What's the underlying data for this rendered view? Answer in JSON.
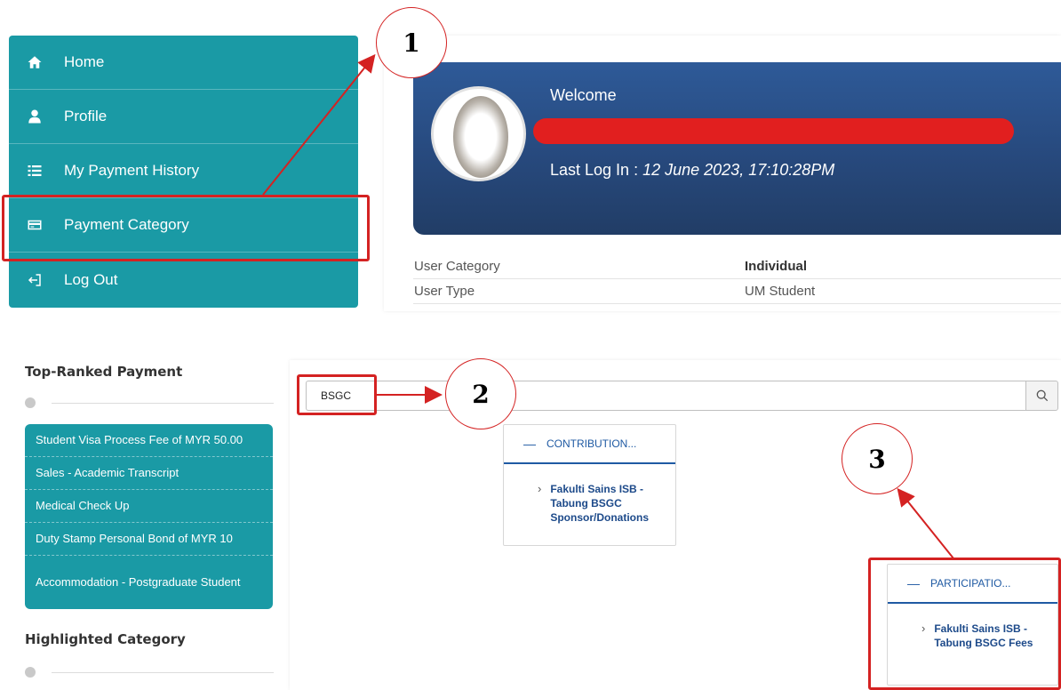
{
  "nav": {
    "items": [
      {
        "label": "Home",
        "icon": "home-icon"
      },
      {
        "label": "Profile",
        "icon": "user-icon"
      },
      {
        "label": "My Payment History",
        "icon": "list-icon"
      },
      {
        "label": "Payment Category",
        "icon": "credit-card-icon"
      },
      {
        "label": "Log Out",
        "icon": "logout-icon"
      }
    ]
  },
  "profile": {
    "welcome": "Welcome",
    "last_login_label": "Last Log In :",
    "last_login_value": "12 June 2023, 17:10:28PM",
    "rows": [
      {
        "label": "User Category",
        "value": "Individual"
      },
      {
        "label": "User Type",
        "value": "UM Student"
      }
    ]
  },
  "annotations": {
    "step1": "1",
    "step2": "2",
    "step3": "3",
    "color": "#d42222"
  },
  "top_ranked": {
    "heading": "Top-Ranked Payment",
    "items": [
      "Student Visa Process Fee of MYR 50.00",
      "Sales - Academic Transcript",
      "Medical Check Up",
      "Duty Stamp Personal Bond of MYR 10",
      "Accommodation - Postgraduate Student"
    ]
  },
  "highlighted": {
    "heading": "Highlighted Category"
  },
  "search": {
    "value": "BSGC",
    "button_icon": "search-icon"
  },
  "results": [
    {
      "category": "CONTRIBUTION...",
      "item": "Fakulti Sains ISB - Tabung BSGC Sponsor/Donations"
    },
    {
      "category": "PARTICIPATIO...",
      "item": "Fakulti Sains ISB - Tabung BSGC Fees"
    }
  ],
  "colors": {
    "teal": "#1a9aa5",
    "navy": "#27497d",
    "link": "#1f5aa3",
    "redaction": "#e11f1f"
  }
}
